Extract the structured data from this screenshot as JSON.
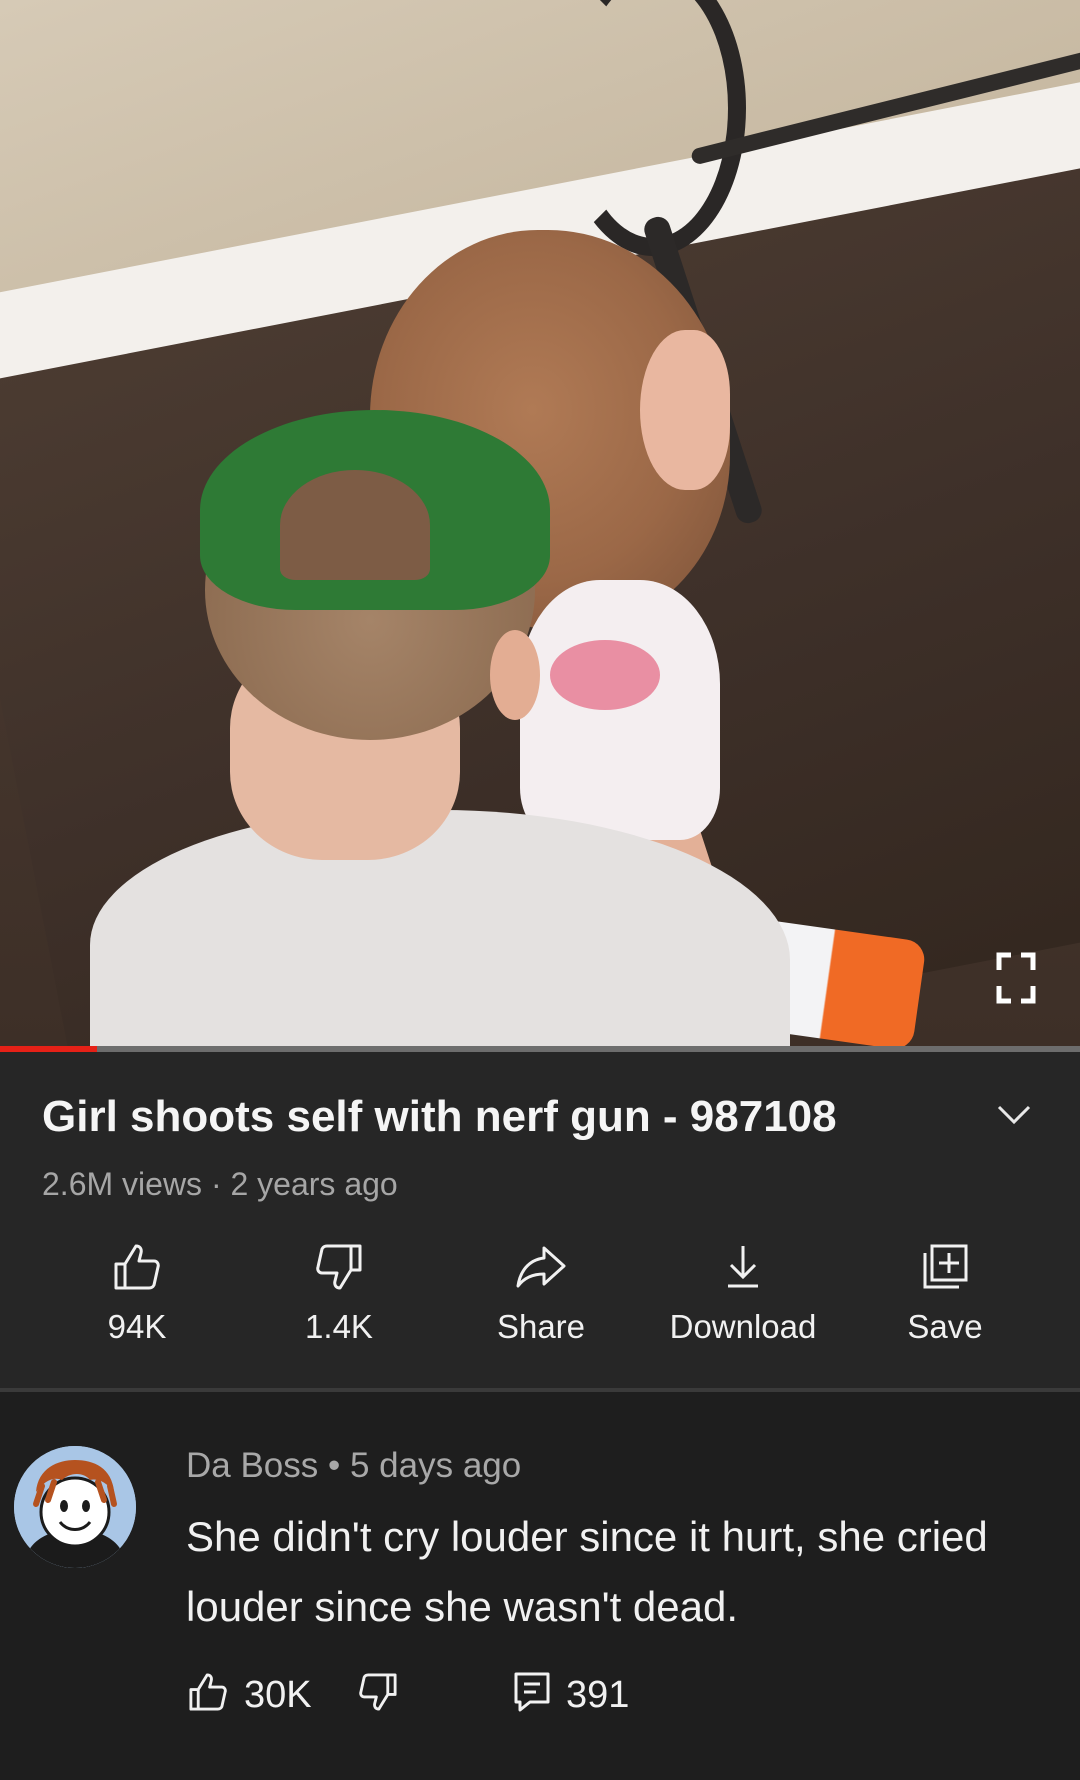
{
  "video": {
    "progress_fraction": 0.09,
    "accent_color": "#e62117"
  },
  "info": {
    "title": "Girl shoots self with nerf gun - 987108",
    "views": "2.6M views",
    "separator": " · ",
    "age": "2 years ago"
  },
  "actions": {
    "like_label": "94K",
    "dislike_label": "1.4K",
    "share_label": "Share",
    "download_label": "Download",
    "save_label": "Save"
  },
  "comment": {
    "author": "Da Boss",
    "separator": " • ",
    "age": "5 days ago",
    "text": "She didn't cry louder since it hurt, she cried louder since she wasn't dead.",
    "like_count": "30K",
    "reply_count": "391"
  },
  "icons": {
    "fullscreen": "fullscreen-icon",
    "expand": "chevron-down-icon",
    "like": "thumbs-up-icon",
    "dislike": "thumbs-down-icon",
    "share": "share-arrow-icon",
    "download": "download-icon",
    "save": "save-to-playlist-icon",
    "reply": "reply-icon"
  }
}
